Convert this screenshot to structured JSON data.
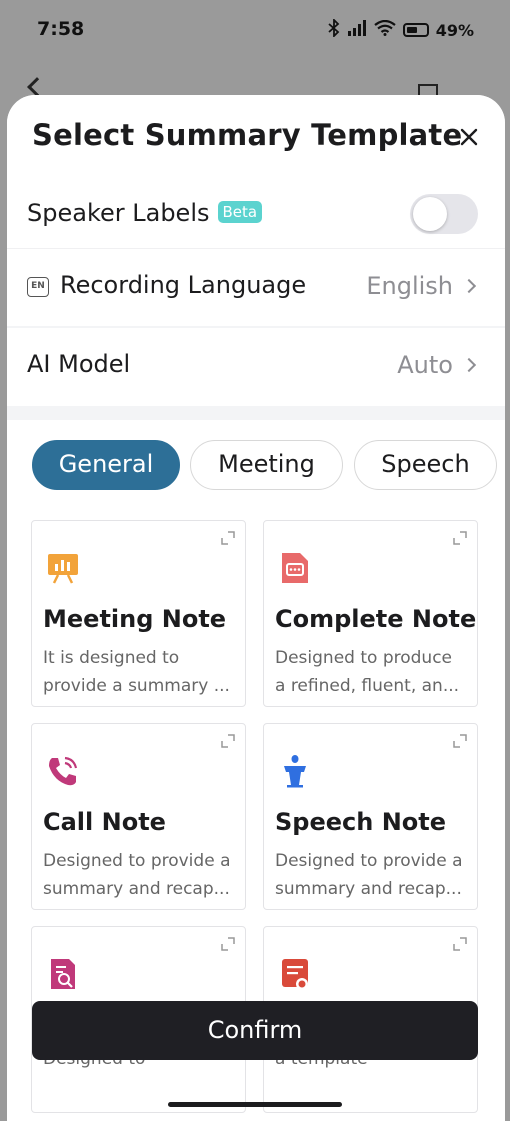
{
  "status_bar": {
    "time": "7:58",
    "battery": "49%"
  },
  "sheet": {
    "title": "Select Summary Template"
  },
  "settings": {
    "speaker_labels": {
      "label": "Speaker Labels",
      "badge": "Beta",
      "enabled": false
    },
    "recording_language": {
      "icon_text": "EN",
      "label": "Recording Language",
      "value": "English"
    },
    "ai_model": {
      "label": "AI Model",
      "value": "Auto"
    }
  },
  "tabs": [
    {
      "label": "General",
      "active": true
    },
    {
      "label": "Meeting",
      "active": false
    },
    {
      "label": "Speech",
      "active": false
    }
  ],
  "templates": [
    {
      "title": "Meeting Note",
      "desc1": "It is designed to",
      "desc2": "provide a summary ...",
      "icon": "presentation-chart-icon",
      "color": "#f2a33a"
    },
    {
      "title": "Complete Note",
      "desc1": "Designed to produce",
      "desc2": "a refined, fluent, an...",
      "icon": "document-chat-icon",
      "color": "#e86a6a"
    },
    {
      "title": "Call Note",
      "desc1": "Designed to provide a",
      "desc2": "summary and recap...",
      "icon": "phone-call-icon",
      "color": "#c0397a"
    },
    {
      "title": "Speech Note",
      "desc1": "Designed to provide a",
      "desc2": "summary and recap...",
      "icon": "podium-icon",
      "color": "#2f6fe0"
    },
    {
      "title": "",
      "desc1": "Designed to",
      "desc2": "",
      "icon": "document-search-icon",
      "color": "#c0397a"
    },
    {
      "title": "",
      "desc1": "a template",
      "desc2": "",
      "icon": "document-record-icon",
      "color": "#d94a3a"
    }
  ],
  "confirm_label": "Confirm",
  "colors": {
    "accent": "#2d6f97",
    "beta": "#5bd3cf",
    "confirm_bg": "#1f1f24"
  }
}
